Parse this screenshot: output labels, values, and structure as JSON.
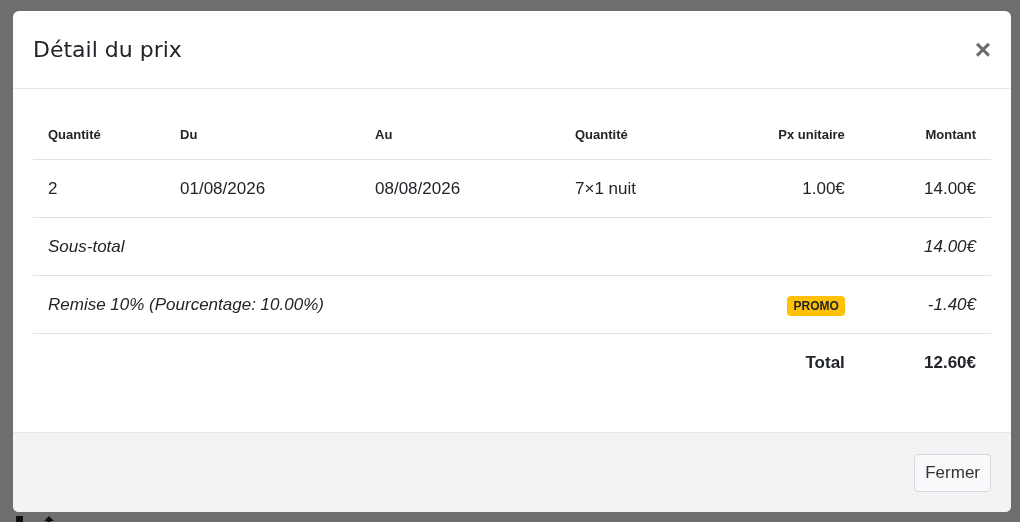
{
  "modal": {
    "title": "Détail du prix",
    "close": "×",
    "table": {
      "columns": [
        "Quantité",
        "Du",
        "Au",
        "Quantité",
        "Px unitaire",
        "Montant"
      ],
      "rows": [
        {
          "kind": "line",
          "cells": [
            "2",
            "01/08/2026",
            "08/08/2026",
            "7×1 nuit",
            "1.00€",
            "14.00€"
          ]
        },
        {
          "kind": "subtotal",
          "label": "Sous-total",
          "amount": "14.00€"
        },
        {
          "kind": "discount",
          "label": "Remise 10% (Pourcentage: 10.00%)",
          "badge": "PROMO",
          "amount": "-1.40€"
        },
        {
          "kind": "total",
          "label": "Total",
          "amount": "12.60€"
        }
      ]
    },
    "footer": {
      "button": "Fermer"
    }
  }
}
